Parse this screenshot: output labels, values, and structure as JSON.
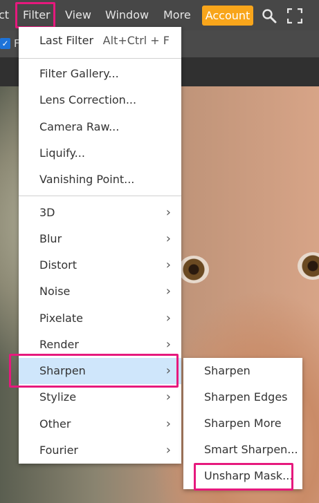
{
  "menubar": {
    "items": [
      {
        "label": "ct"
      },
      {
        "label": "Filter"
      },
      {
        "label": "View"
      },
      {
        "label": "Window"
      },
      {
        "label": "More"
      }
    ],
    "account_label": "Account",
    "accent_color": "#f8a51b"
  },
  "toolbar": {
    "checkbox_checked": true,
    "checkbox_label": "F"
  },
  "filter_menu": {
    "items": [
      {
        "label": "Last Filter",
        "shortcut": "Alt+Ctrl + F"
      },
      {
        "label": "Filter Gallery..."
      },
      {
        "label": "Lens Correction..."
      },
      {
        "label": "Camera Raw..."
      },
      {
        "label": "Liquify..."
      },
      {
        "label": "Vanishing Point..."
      },
      {
        "label": "3D",
        "submenu": true
      },
      {
        "label": "Blur",
        "submenu": true
      },
      {
        "label": "Distort",
        "submenu": true
      },
      {
        "label": "Noise",
        "submenu": true
      },
      {
        "label": "Pixelate",
        "submenu": true
      },
      {
        "label": "Render",
        "submenu": true
      },
      {
        "label": "Sharpen",
        "submenu": true,
        "active": true
      },
      {
        "label": "Stylize",
        "submenu": true
      },
      {
        "label": "Other",
        "submenu": true
      },
      {
        "label": "Fourier",
        "submenu": true
      }
    ],
    "chevron": "›"
  },
  "sharpen_submenu": {
    "items": [
      {
        "label": "Sharpen"
      },
      {
        "label": "Sharpen Edges"
      },
      {
        "label": "Sharpen More"
      },
      {
        "label": "Smart Sharpen..."
      },
      {
        "label": "Unsharp Mask..."
      }
    ]
  },
  "highlight_color": "#e6197d",
  "icons": [
    "search-icon",
    "fullscreen-icon",
    "chevron-right-icon",
    "checkmark-icon"
  ]
}
